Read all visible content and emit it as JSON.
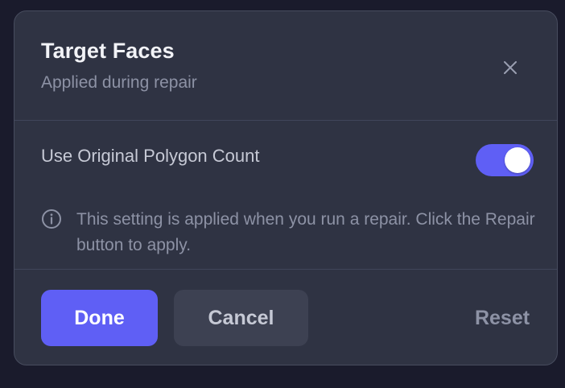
{
  "dialog": {
    "title": "Target Faces",
    "subtitle": "Applied during repair",
    "close_icon": "close-icon"
  },
  "setting": {
    "label": "Use Original Polygon Count",
    "enabled": true
  },
  "info": {
    "icon": "info-icon",
    "text": "This setting is applied when you run a repair. Click the Repair button to apply."
  },
  "footer": {
    "done_label": "Done",
    "cancel_label": "Cancel",
    "reset_label": "Reset"
  },
  "colors": {
    "accent": "#5f5ff5",
    "panel": "#2f3343",
    "background": "#1a1b2c"
  }
}
